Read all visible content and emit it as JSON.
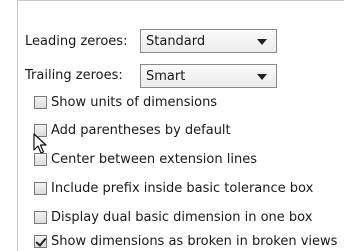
{
  "fields": {
    "leading_label": "Leading zeroes:",
    "leading_value": "Standard",
    "trailing_label": "Trailing zeroes:",
    "trailing_value": "Smart"
  },
  "options": [
    {
      "label": "Show units of dimensions",
      "checked": false
    },
    {
      "label": "Add parentheses by default",
      "checked": false
    },
    {
      "label": "Center between extension lines",
      "checked": false
    },
    {
      "label": "Include prefix inside basic tolerance box",
      "checked": false
    },
    {
      "label": "Display dual basic dimension in one box",
      "checked": false
    },
    {
      "label": "Show dimensions as broken in broken views",
      "checked": true
    }
  ]
}
